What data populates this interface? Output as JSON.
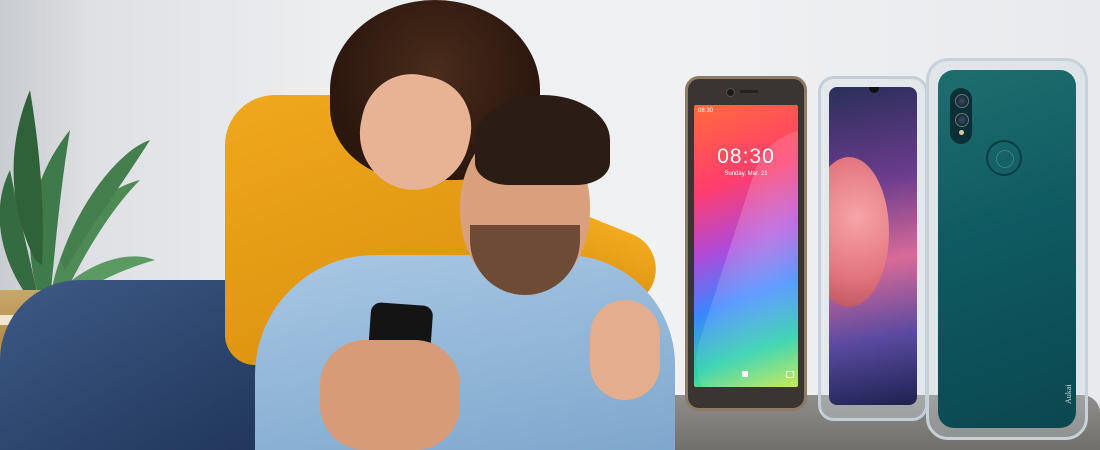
{
  "banner": {
    "phone1": {
      "clock": "08:30",
      "date": "Sunday, Mar. 21"
    },
    "phone3": {
      "case_brand": "Aukai"
    }
  }
}
